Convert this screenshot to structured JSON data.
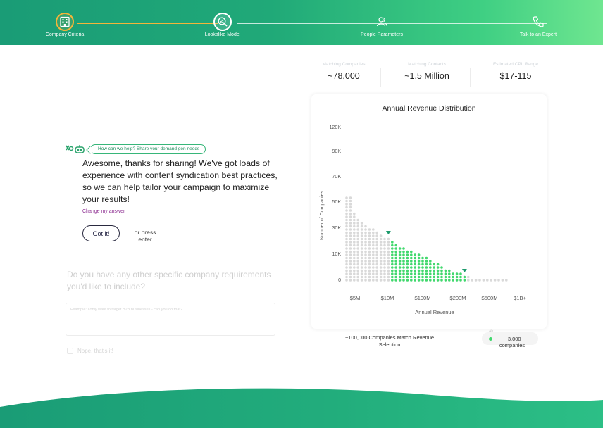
{
  "progress": {
    "steps": [
      {
        "label": "Company Criteria",
        "icon": "building-icon",
        "state": "active"
      },
      {
        "label": "Lookalike Model",
        "icon": "search-network-icon",
        "state": "done"
      },
      {
        "label": "People Parameters",
        "icon": "people-icon",
        "state": "todo"
      },
      {
        "label": "Talk to an Expert",
        "icon": "phone-icon",
        "state": "todo"
      }
    ]
  },
  "chat": {
    "question": "How can we help? Share your demand gen needs",
    "answer": "Awesome, thanks for sharing! We've got loads of experience with content syndication best practices, so we can help tailor your campaign to maximize your results!",
    "change_answer": "Change my answer",
    "got_it": "Got it!",
    "or_press": "or press enter",
    "next_question": "Do you have any other specific company requirements you'd like to include?",
    "textarea_placeholder": "Example: I only want to target B2B businesses - can you do that?",
    "nope_label": "Nope, that's it!"
  },
  "stats": [
    {
      "label": "Matching Companies",
      "value": "~78,000"
    },
    {
      "label": "Matching Contacts",
      "value": "~1.5 Million"
    },
    {
      "label": "Estimated CPL Range",
      "value": "$17-115"
    }
  ],
  "colors": {
    "accent_green": "#42d86e",
    "inactive_dot": "#d9d9d9",
    "marker": "#1d9a6c",
    "brand_dark": "#1a9c76",
    "brand_light": "#6fe690",
    "step_active": "#f3b53a"
  },
  "chart_footer": {
    "match_text": "~100,000 Companies Match Revenue Selection",
    "legend_value": "~ 3,000 companies",
    "legend_key": "Ab"
  },
  "chart_data": {
    "type": "bar",
    "title": "Annual Revenue Distribution",
    "xlabel": "Annual Revenue",
    "ylabel": "Number of Companies",
    "y_ticks": [
      "0",
      "10K",
      "30K",
      "50K",
      "70K",
      "90K",
      "120K"
    ],
    "x_ticks": [
      "$5M",
      "$10M",
      "$100M",
      "$200M",
      "$500M",
      "$1B+"
    ],
    "dot_columns": [
      27,
      27,
      22,
      20,
      19,
      18,
      17,
      17,
      16,
      15,
      14,
      14,
      13,
      12,
      11,
      11,
      10,
      10,
      9,
      9,
      8,
      8,
      7,
      6,
      6,
      5,
      4,
      4,
      3,
      3,
      3,
      2,
      2,
      1,
      1,
      1,
      1,
      1,
      1,
      1,
      1,
      1,
      1
    ],
    "selected_range": [
      12,
      31
    ],
    "markers_at_columns": [
      11,
      31
    ]
  }
}
